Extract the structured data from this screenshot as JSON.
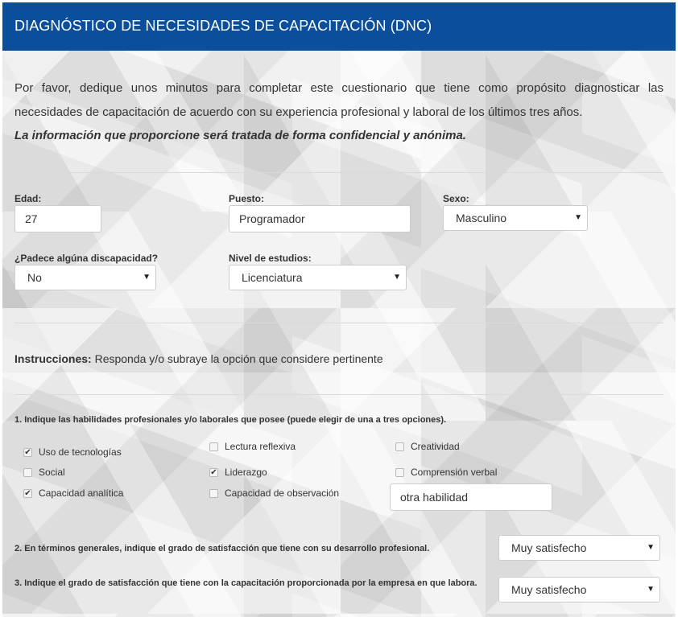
{
  "header": {
    "title": "DIAGNÓSTICO DE NECESIDADES DE CAPACITACIÓN (DNC)"
  },
  "intro": {
    "text": "Por favor, dedique unos minutos para completar este cuestionario que tiene como propósito diagnosticar las necesidades de capacitación de acuerdo con su experiencia profesional y laboral de los últimos tres años.",
    "note": "La información que proporcione será tratada de forma confidencial y anónima."
  },
  "fields": {
    "edad": {
      "label": "Edad:",
      "value": "27"
    },
    "puesto": {
      "label": "Puesto:",
      "value": "Programador"
    },
    "sexo": {
      "label": "Sexo:",
      "value": "Masculino"
    },
    "discapacidad": {
      "label": "¿Padece algúna discapacidad?",
      "value": "No"
    },
    "estudios": {
      "label": "Nivel de estudios:",
      "value": "Licenciatura"
    }
  },
  "instructions": {
    "label": "Instrucciones:",
    "text": " Responda y/o subraye la opción que considere pertinente"
  },
  "q1": {
    "text": "1. Indique las habilidades profesionales y/o laborales que posee (puede elegir de una a tres opciones).",
    "options": [
      {
        "label": "Uso de tecnologías",
        "checked": true
      },
      {
        "label": "Lectura reflexiva",
        "checked": false
      },
      {
        "label": "Creatividad",
        "checked": false
      },
      {
        "label": "Social",
        "checked": false
      },
      {
        "label": "Liderazgo",
        "checked": true
      },
      {
        "label": "Comprensión verbal",
        "checked": false
      },
      {
        "label": "Capacidad analítica",
        "checked": true
      },
      {
        "label": "Capacidad de observación",
        "checked": false
      }
    ],
    "other_value": "otra habilidad"
  },
  "q2": {
    "text": "2. En términos generales, indique el grado de satisfacción que tiene con su desarrollo profesional.",
    "value": "Muy satisfecho"
  },
  "q3": {
    "text": "3. Indique el grado de satisfacción que tiene con la capacitación proporcionada por la empresa en que labora.",
    "value": "Muy satisfecho"
  },
  "icons": {
    "select_arrow": "▼",
    "check_mark": "✔"
  },
  "colors": {
    "header_bg": "#0b4f9c",
    "header_text": "#ffffff"
  }
}
